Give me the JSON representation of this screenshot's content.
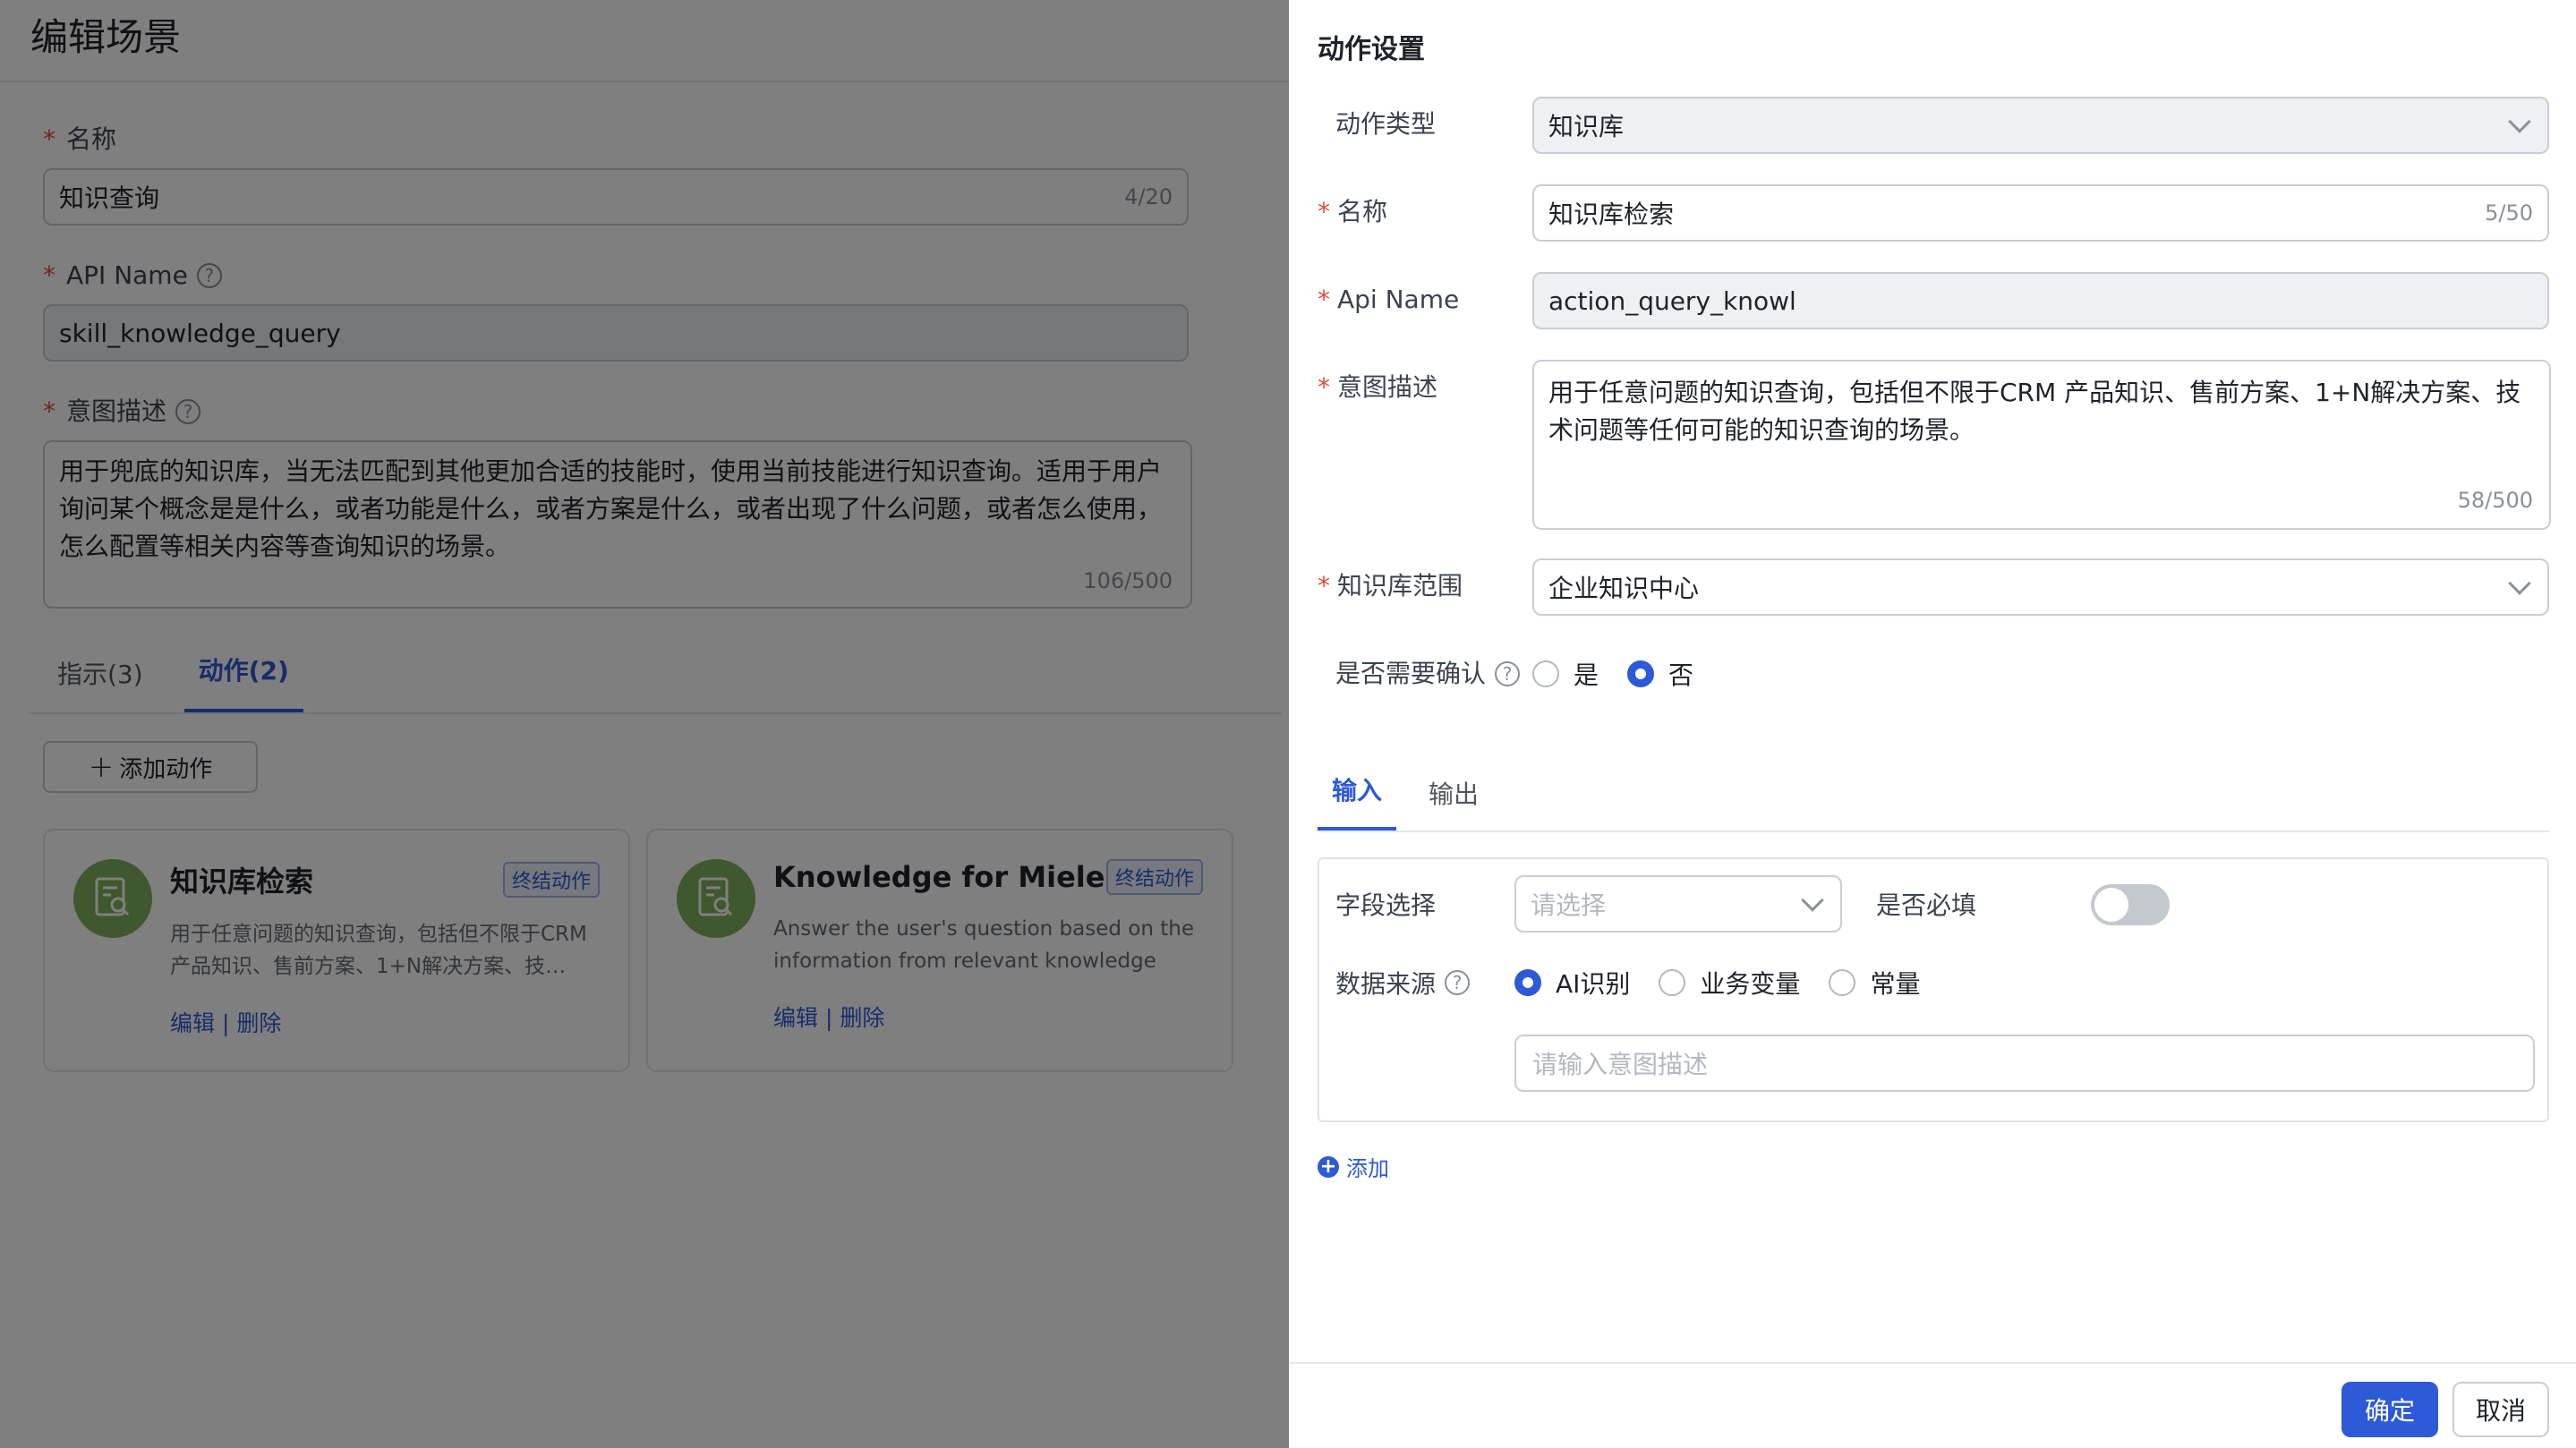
{
  "page": {
    "title": "编辑场景",
    "name_label": "名称",
    "name_value": "知识查询",
    "name_count": "4/20",
    "api_label": "API Name",
    "api_value": "skill_knowledge_query",
    "intent_label": "意图描述",
    "intent_value": "用于兜底的知识库，当无法匹配到其他更加合适的技能时，使用当前技能进行知识查询。适用于用户询问某个概念是是什么，或者功能是什么，或者方案是什么，或者出现了什么问题，或者怎么使用，怎么配置等相关内容等查询知识的场景。",
    "intent_count": "106/500",
    "tabs": [
      {
        "label": "指示(3)",
        "active": false
      },
      {
        "label": "动作(2)",
        "active": true
      }
    ],
    "add_action_label": "添加动作",
    "cards": [
      {
        "title": "知识库检索",
        "badge": "终结动作",
        "desc": "用于任意问题的知识查询，包括但不限于CRM 产品知识、售前方案、1+N解决方案、技…",
        "edit": "编辑",
        "sep": "|",
        "delete": "删除",
        "icon": "knowledge-search-icon"
      },
      {
        "title": "Knowledge for Miele",
        "badge": "终结动作",
        "desc": "Answer the user's question based on the information from relevant knowledge articles in…",
        "edit": "编辑",
        "sep": "|",
        "delete": "删除",
        "icon": "knowledge-search-icon"
      }
    ]
  },
  "drawer": {
    "title": "动作设置",
    "action_type_label": "动作类型",
    "action_type_value": "知识库",
    "name_label": "名称",
    "name_value": "知识库检索",
    "name_count": "5/50",
    "api_label": "Api Name",
    "api_value": "action_query_knowl",
    "intent_label": "意图描述",
    "intent_value": "用于任意问题的知识查询，包括但不限于CRM 产品知识、售前方案、1+N解决方案、技术问题等任何可能的知识查询的场景。",
    "intent_count": "58/500",
    "scope_label": "知识库范围",
    "scope_value": "企业知识中心",
    "confirm_label": "是否需要确认",
    "confirm_options": [
      {
        "label": "是",
        "checked": false
      },
      {
        "label": "否",
        "checked": true
      }
    ],
    "tabs": [
      {
        "label": "输入",
        "active": true
      },
      {
        "label": "输出",
        "active": false
      }
    ],
    "field_select_label": "字段选择",
    "field_select_placeholder": "请选择",
    "required_label": "是否必填",
    "required_on": false,
    "source_label": "数据来源",
    "source_options": [
      {
        "label": "AI识别",
        "checked": true
      },
      {
        "label": "业务变量",
        "checked": false
      },
      {
        "label": "常量",
        "checked": false
      }
    ],
    "intent_input_placeholder": "请输入意图描述",
    "add_label": "添加",
    "ok_label": "确定",
    "cancel_label": "取消"
  },
  "colors": {
    "primary": "#2d5ad6",
    "required": "#e24a3b",
    "card_icon_bg": "#7fb15a",
    "mask": "rgba(0,0,0,0.5)"
  }
}
